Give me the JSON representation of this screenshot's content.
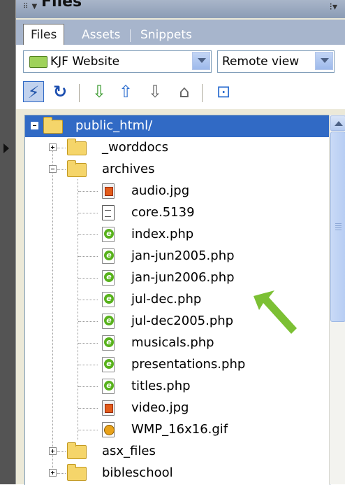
{
  "panel": {
    "title": "Files"
  },
  "tabs": [
    {
      "label": "Files",
      "active": true
    },
    {
      "label": "Assets",
      "active": false
    },
    {
      "label": "Snippets",
      "active": false
    }
  ],
  "site_select": {
    "value": "KJF Website"
  },
  "view_select": {
    "value": "Remote view"
  },
  "toolbar": {
    "icons": [
      "connect-icon",
      "refresh-icon",
      "get-icon",
      "put-icon",
      "check-out-icon",
      "check-in-icon",
      "expand-icon"
    ]
  },
  "tree": {
    "root": {
      "label": "public_html/",
      "expanded": true
    },
    "items": [
      {
        "label": "_worddocs",
        "kind": "folder",
        "expanded": false
      },
      {
        "label": "archives",
        "kind": "folder",
        "expanded": true
      },
      {
        "label": "audio.jpg",
        "kind": "jpg"
      },
      {
        "label": "core.5139",
        "kind": "file"
      },
      {
        "label": "index.php",
        "kind": "php"
      },
      {
        "label": "jan-jun2005.php",
        "kind": "php"
      },
      {
        "label": "jan-jun2006.php",
        "kind": "php"
      },
      {
        "label": "jul-dec.php",
        "kind": "php"
      },
      {
        "label": "jul-dec2005.php",
        "kind": "php"
      },
      {
        "label": "musicals.php",
        "kind": "php"
      },
      {
        "label": "presentations.php",
        "kind": "php"
      },
      {
        "label": "titles.php",
        "kind": "php"
      },
      {
        "label": "video.jpg",
        "kind": "jpg"
      },
      {
        "label": "WMP_16x16.gif",
        "kind": "gif"
      },
      {
        "label": "asx_files",
        "kind": "folder",
        "expanded": false
      },
      {
        "label": "bibleschool",
        "kind": "folder",
        "expanded": false
      }
    ]
  },
  "colors": {
    "selection": "#316ac5",
    "tab_bar": "#a7b5cc",
    "annotation_arrow": "#7cc034"
  }
}
